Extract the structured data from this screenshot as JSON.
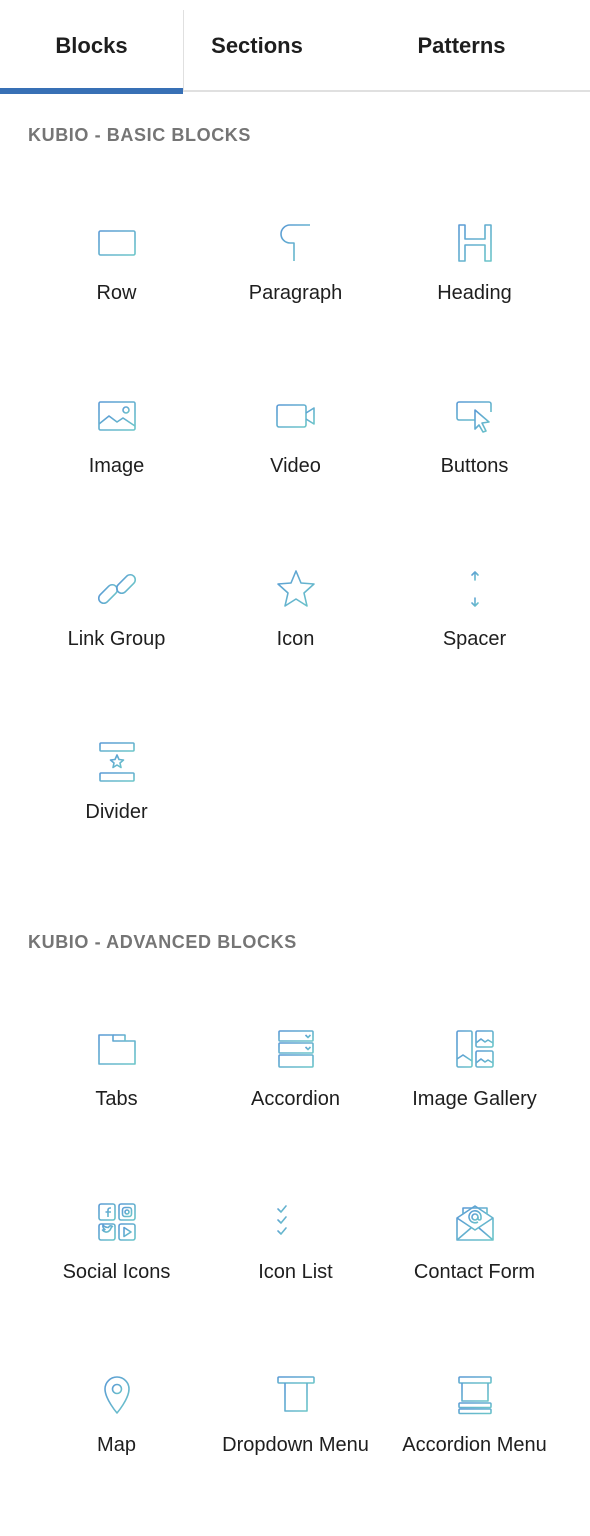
{
  "tabs": [
    {
      "label": "Blocks",
      "active": true
    },
    {
      "label": "Sections",
      "active": false
    },
    {
      "label": "Patterns",
      "active": false
    }
  ],
  "accent_color": "#3870b5",
  "icon_gradient": [
    "#5b9bd5",
    "#6cc5c9"
  ],
  "sections": [
    {
      "title": "KUBIO - BASIC BLOCKS",
      "blocks": [
        {
          "label": "Row",
          "icon": "columns-icon"
        },
        {
          "label": "Paragraph",
          "icon": "paragraph-icon"
        },
        {
          "label": "Heading",
          "icon": "heading-icon"
        },
        {
          "label": "Image",
          "icon": "image-icon"
        },
        {
          "label": "Video",
          "icon": "video-icon"
        },
        {
          "label": "Buttons",
          "icon": "button-cursor-icon"
        },
        {
          "label": "Link Group",
          "icon": "link-icon"
        },
        {
          "label": "Icon",
          "icon": "star-icon"
        },
        {
          "label": "Spacer",
          "icon": "spacer-icon"
        },
        {
          "label": "Divider",
          "icon": "divider-icon"
        }
      ]
    },
    {
      "title": "KUBIO - ADVANCED BLOCKS",
      "blocks": [
        {
          "label": "Tabs",
          "icon": "folder-tabs-icon"
        },
        {
          "label": "Accordion",
          "icon": "accordion-icon"
        },
        {
          "label": "Image Gallery",
          "icon": "gallery-icon"
        },
        {
          "label": "Social Icons",
          "icon": "social-grid-icon"
        },
        {
          "label": "Icon List",
          "icon": "checklist-icon"
        },
        {
          "label": "Contact Form",
          "icon": "envelope-at-icon"
        },
        {
          "label": "Map",
          "icon": "map-pin-icon"
        },
        {
          "label": "Dropdown Menu",
          "icon": "dropdown-menu-icon"
        },
        {
          "label": "Accordion Menu",
          "icon": "accordion-menu-icon"
        }
      ]
    }
  ]
}
